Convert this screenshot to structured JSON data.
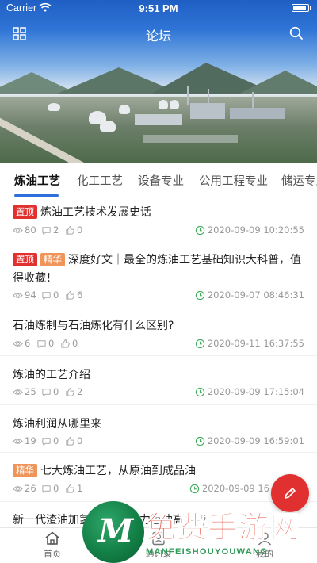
{
  "status_bar": {
    "carrier": "Carrier",
    "time": "9:51 PM"
  },
  "nav": {
    "title": "论坛",
    "left_icon": "grid-menu-icon",
    "right_icon": "search-icon"
  },
  "tabs": [
    {
      "label": "炼油工艺",
      "active": true
    },
    {
      "label": "化工工艺",
      "active": false
    },
    {
      "label": "设备专业",
      "active": false
    },
    {
      "label": "公用工程专业",
      "active": false
    },
    {
      "label": "储运专业",
      "active": false
    }
  ],
  "posts": [
    {
      "tags": [
        "置顶"
      ],
      "title": "炼油工艺技术发展史话",
      "views": "80",
      "comments": "2",
      "likes": "0",
      "date": "2020-09-09 10:20:55"
    },
    {
      "tags": [
        "置顶",
        "精华"
      ],
      "title": "深度好文｜最全的炼油工艺基础知识大科普，值得收藏！",
      "views": "94",
      "comments": "0",
      "likes": "6",
      "date": "2020-09-07 08:46:31"
    },
    {
      "tags": [],
      "title": "石油炼制与石油炼化有什么区别?",
      "views": "6",
      "comments": "0",
      "likes": "0",
      "date": "2020-09-11 16:37:55"
    },
    {
      "tags": [],
      "title": "炼油的工艺介绍",
      "views": "25",
      "comments": "0",
      "likes": "2",
      "date": "2020-09-09 17:15:04"
    },
    {
      "tags": [],
      "title": "炼油利润从哪里来",
      "views": "19",
      "comments": "0",
      "likes": "0",
      "date": "2020-09-09 16:59:01"
    },
    {
      "tags": [
        "精华"
      ],
      "title": "七大炼油工艺，从原油到成品油",
      "views": "26",
      "comments": "0",
      "likes": "1",
      "date": "2020-09-09 16"
    },
    {
      "tags": [],
      "title": "新一代渣油加氢",
      "title_tail": "力重油高效转",
      "views": "",
      "comments": "",
      "likes": "",
      "date": ""
    }
  ],
  "fab": {
    "icon": "edit-pen-icon"
  },
  "bottom_tabs": [
    {
      "label": "首页",
      "icon": "home-icon"
    },
    {
      "label": "通讯录",
      "icon": "contacts-icon"
    },
    {
      "label": "我的",
      "icon": "profile-icon"
    }
  ],
  "watermark": {
    "logo_letter": "M",
    "text": "免费手游网",
    "subtext": "MANFEISHOUYOUWANG"
  },
  "colors": {
    "accent": "#2e6fdb",
    "tag_top": "#e0312f",
    "tag_elite": "#f0955a",
    "fab": "#e0302f",
    "clock_green": "#3fae5c"
  }
}
